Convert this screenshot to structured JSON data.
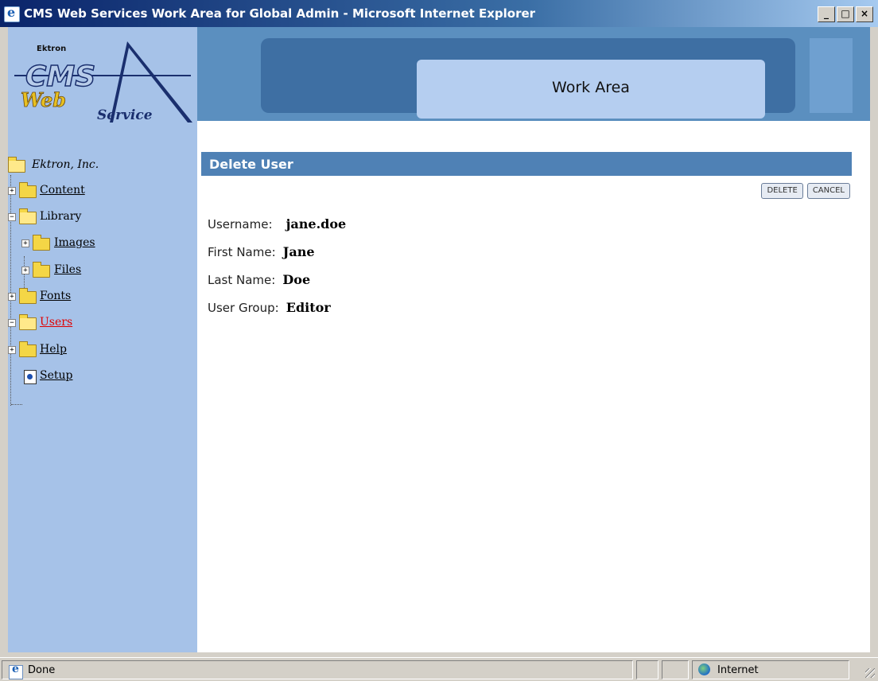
{
  "window": {
    "title": "CMS Web Services Work Area for Global Admin - Microsoft Internet Explorer",
    "minimize_label": "_",
    "maximize_label": "□",
    "close_label": "×"
  },
  "logo": {
    "brand": "Ektron",
    "product_line1": "CMS",
    "product_line2": "Web",
    "product_line3": "Service"
  },
  "header": {
    "title": "Work Area"
  },
  "tree": {
    "root": "Ektron, Inc.",
    "content": "Content",
    "library": "Library",
    "images": "Images",
    "files": "Files",
    "fonts": "Fonts",
    "users": "Users",
    "help": "Help",
    "setup": "Setup",
    "expand_glyph": "+",
    "collapse_glyph": "−"
  },
  "main": {
    "section_title": "Delete User",
    "delete_label": "DELETE",
    "cancel_label": "CANCEL",
    "fields": {
      "username_label": "Username:",
      "username_value": "jane.doe",
      "first_name_label": "First Name:",
      "first_name_value": "Jane",
      "last_name_label": "Last Name:",
      "last_name_value": "Doe",
      "user_group_label": "User Group:",
      "user_group_value": "Editor"
    }
  },
  "status": {
    "text": "Done",
    "zone": "Internet"
  },
  "colors": {
    "accent": "#4f81b5",
    "sidebar": "#a6c2e8",
    "active_link": "#e00000"
  }
}
